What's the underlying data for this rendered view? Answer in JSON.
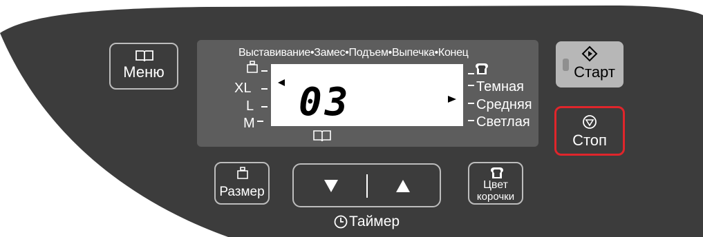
{
  "menu": {
    "label": "Меню",
    "icon": "book-icon"
  },
  "display": {
    "program_steps": [
      "Выставивание",
      "Замес",
      "Подъем",
      "Выпечка",
      "Конец"
    ],
    "program_steps_text": "Выставивание•Замес•Подъем•Выпечка•Конец",
    "value": "03",
    "sizes": [
      "XL",
      "L",
      "M"
    ],
    "crusts": [
      "Темная",
      "Средняя",
      "Светлая"
    ],
    "size_icon": "weight-icon",
    "crust_icon": "bread-icon",
    "menu_icon": "book-icon"
  },
  "start": {
    "label": "Старт",
    "icon": "start-diamond-icon",
    "indicator": "led-indicator"
  },
  "stop": {
    "label": "Стоп",
    "icon": "stop-circle-icon",
    "highlight_color": "#e0252b"
  },
  "size_button": {
    "label": "Размер",
    "icon": "weight-icon"
  },
  "crust_button": {
    "label_line1": "Цвет",
    "label_line2": "корочки",
    "icon": "bread-icon"
  },
  "timer": {
    "label": "Таймер",
    "icon": "clock-icon",
    "down_icon": "triangle-down-icon",
    "up_icon": "triangle-up-icon"
  },
  "colors": {
    "panel": "#3c3c3c",
    "lcd_frame": "#5d5d5d",
    "start_button": "#b7b7b7",
    "stop_border": "#e0252b"
  }
}
